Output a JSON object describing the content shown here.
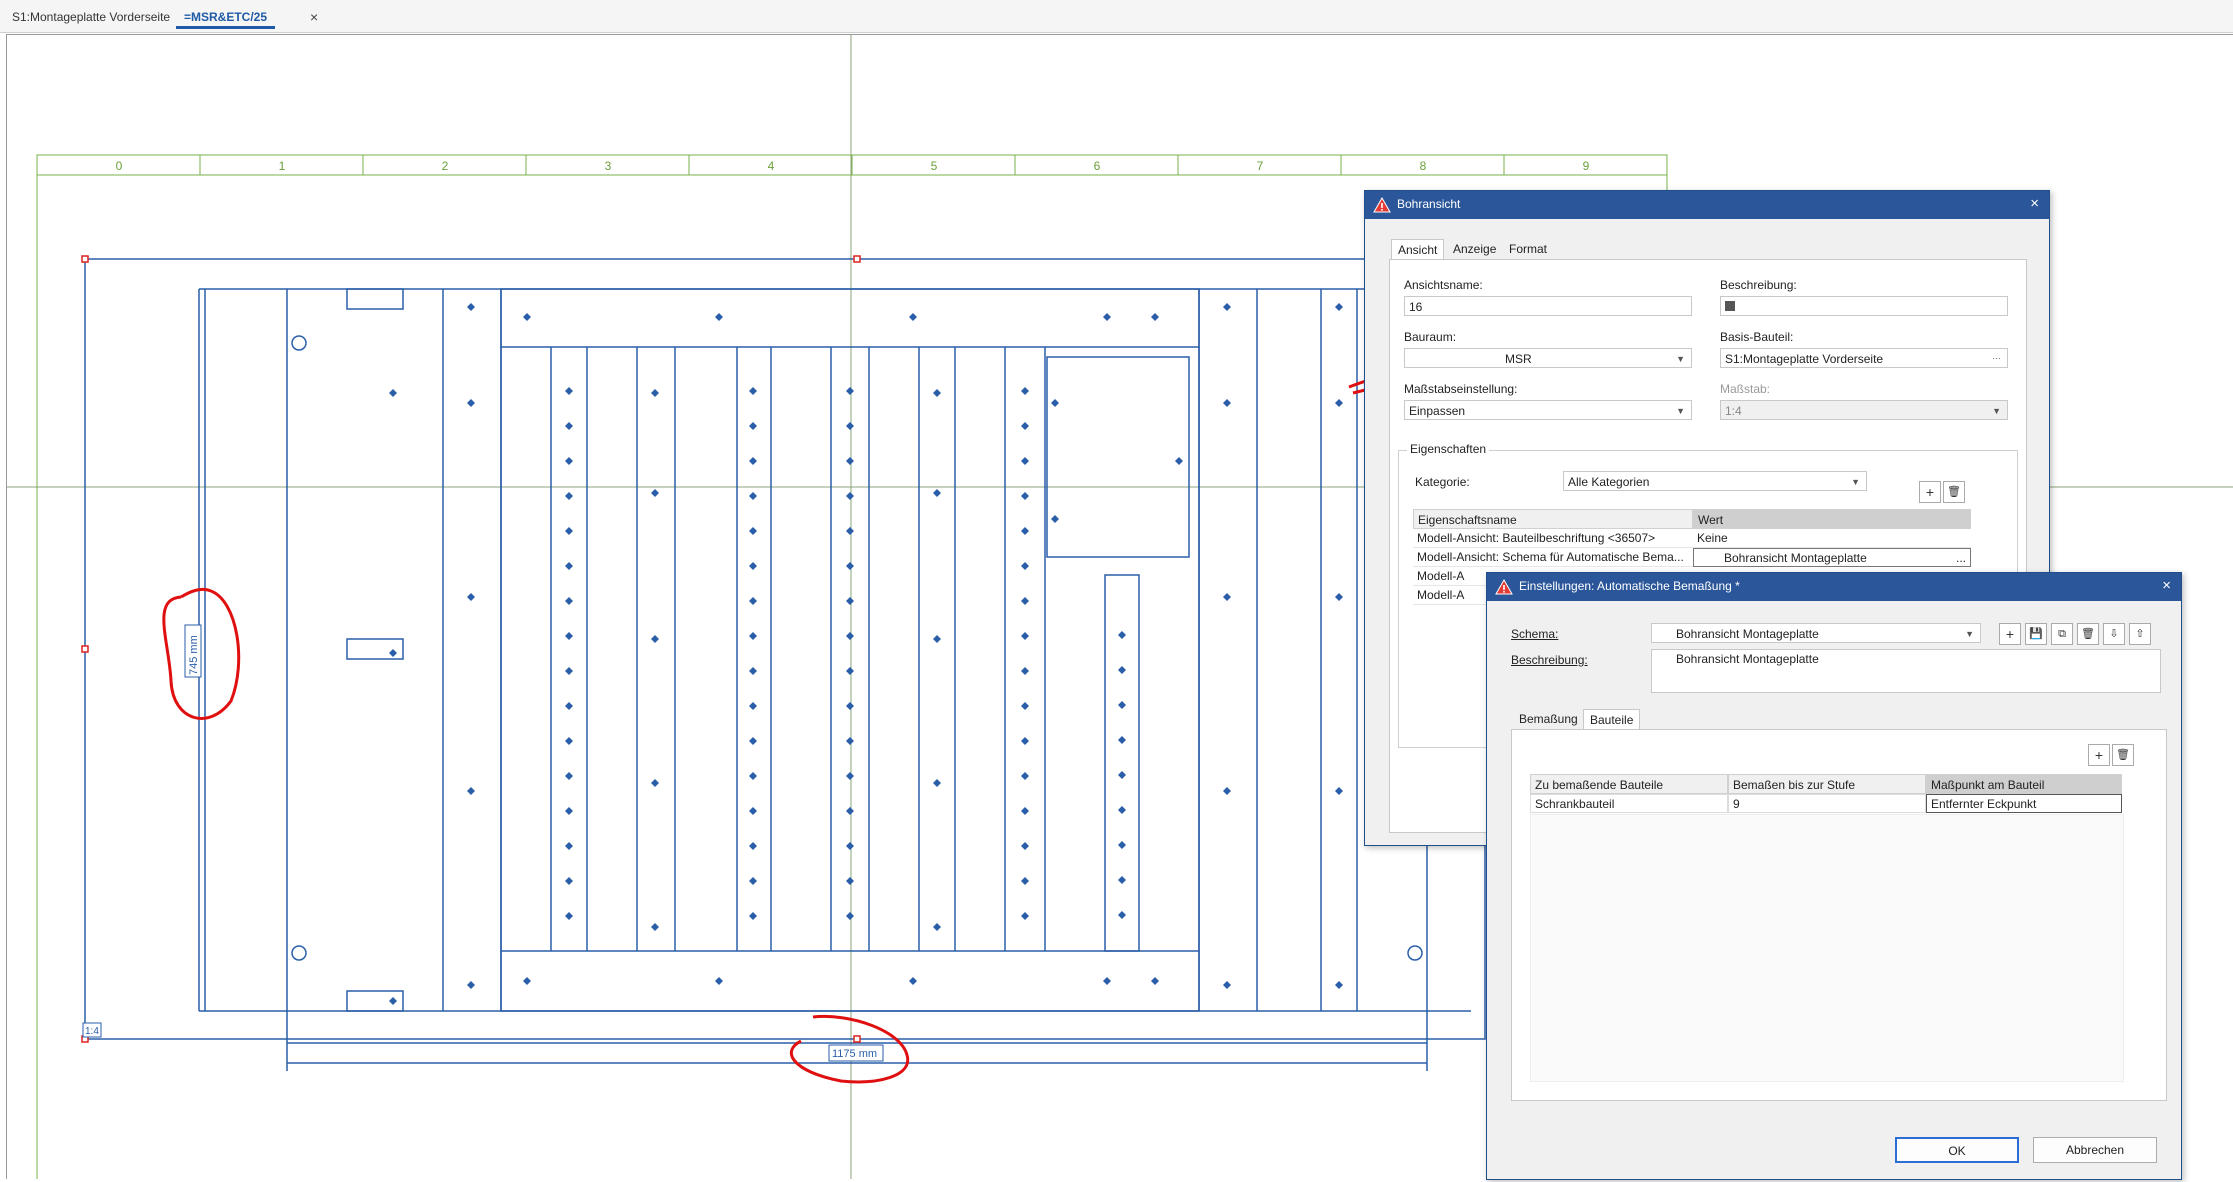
{
  "tabs": [
    {
      "label": "S1:Montageplatte Vorderseite",
      "active": false
    },
    {
      "label": "=MSR&ETC/25",
      "active": true
    }
  ],
  "drawing": {
    "ruler_labels": [
      "0",
      "1",
      "2",
      "3",
      "4",
      "5",
      "6",
      "7",
      "8",
      "9"
    ],
    "height_dim": "745 mm",
    "width_dim": "1175 mm",
    "scale_marker": "1:4"
  },
  "dialog_bohransicht": {
    "title": "Bohransicht",
    "tabs": [
      "Ansicht",
      "Anzeige",
      "Format"
    ],
    "ansichtsname_label": "Ansichtsname:",
    "ansichtsname_value": "16",
    "beschreibung_label": "Beschreibung:",
    "bauraum_label": "Bauraum:",
    "bauraum_value": "MSR",
    "basis_label": "Basis-Bauteil:",
    "basis_value": "S1:Montageplatte Vorderseite",
    "massstabseinstellung_label": "Maßstabseinstellung:",
    "massstabseinstellung_value": "Einpassen",
    "massstab_label": "Maßstab:",
    "massstab_value": "1:4",
    "eigenschaften_label": "Eigenschaften",
    "kategorie_label": "Kategorie:",
    "kategorie_value": "Alle Kategorien",
    "grid_headers": [
      "Eigenschaftsname",
      "Wert"
    ],
    "grid_rows": [
      {
        "name": "Modell-Ansicht: Bauteilbeschriftung <36507>",
        "value": "Keine"
      },
      {
        "name": "Modell-Ansicht: Schema für Automatische Bema...",
        "value": "Bohransicht Montageplatte"
      },
      {
        "name": "Modell-A",
        "value": ""
      },
      {
        "name": "Modell-A",
        "value": ""
      }
    ],
    "browse_label": "..."
  },
  "dialog_einstellungen": {
    "title": "Einstellungen: Automatische Bemaßung *",
    "schema_label": "Schema:",
    "schema_value": "Bohransicht Montageplatte",
    "beschreibung_label": "Beschreibung:",
    "beschreibung_value": "Bohransicht Montageplatte",
    "tabs": [
      "Bemaßung",
      "Bauteile"
    ],
    "grid_headers": [
      "Zu bemaßende Bauteile",
      "Bemaßen bis zur Stufe",
      "Maßpunkt am Bauteil"
    ],
    "grid_rows": [
      {
        "bauteile": "Schrankbauteil",
        "stufe": "9",
        "masspunkt": "Entfernter Eckpunkt"
      }
    ],
    "ok_label": "OK",
    "cancel_label": "Abbrechen"
  },
  "annotation_question": "?"
}
